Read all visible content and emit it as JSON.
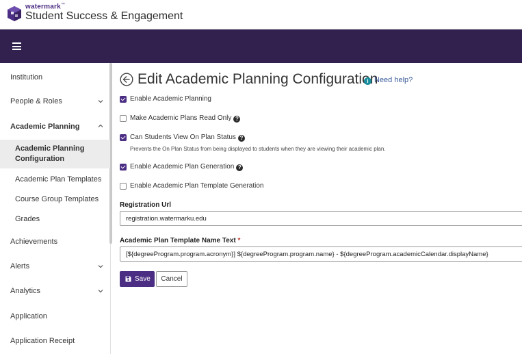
{
  "header": {
    "brand_small": "watermark",
    "brand_tm": "™",
    "app_title": "Student Success & Engagement"
  },
  "sidebar": {
    "items": [
      {
        "label": "Institution"
      },
      {
        "label": "People & Roles"
      },
      {
        "label": "Academic Planning"
      },
      {
        "label": "Achievements"
      },
      {
        "label": "Alerts"
      },
      {
        "label": "Analytics"
      },
      {
        "label": "Application"
      },
      {
        "label": "Application Receipt"
      }
    ],
    "sub_items": [
      {
        "label_line1": "Academic Planning",
        "label_line2": "Configuration"
      },
      {
        "label": "Academic Plan Templates"
      },
      {
        "label": "Course Group Templates"
      },
      {
        "label": "Grades"
      }
    ]
  },
  "page": {
    "title": "Edit Academic Planning Configuration",
    "help_icon": "i",
    "help_label": "Need help?"
  },
  "options": [
    {
      "label": "Enable Academic Planning",
      "checked": true
    },
    {
      "label": "Make Academic Plans Read Only",
      "checked": false,
      "has_help": true
    },
    {
      "label": "Can Students View On Plan Status",
      "checked": true,
      "has_help": true,
      "hint": "Prevents the On Plan Status from being displayed to students when they are viewing their academic plan."
    },
    {
      "label": "Enable Academic Plan Generation",
      "checked": true,
      "has_help": true
    },
    {
      "label": "Enable Academic Plan Template Generation",
      "checked": false
    }
  ],
  "question_icon": "?",
  "form": {
    "registration_url_label": "Registration Url",
    "registration_url_value": "registration.watermarku.edu",
    "template_name_label": "Academic Plan Template Name Text",
    "template_name_required": "*",
    "template_name_value": "[${degreeProgram.program.acronym}] ${degreeProgram.program.name} - ${degreeProgram.academicCalendar.displayName}"
  },
  "buttons": {
    "save": "Save",
    "cancel": "Cancel"
  },
  "colors": {
    "accent": "#4b2d83",
    "navbar": "#32204e",
    "help_icon": "#1b8e9e"
  }
}
